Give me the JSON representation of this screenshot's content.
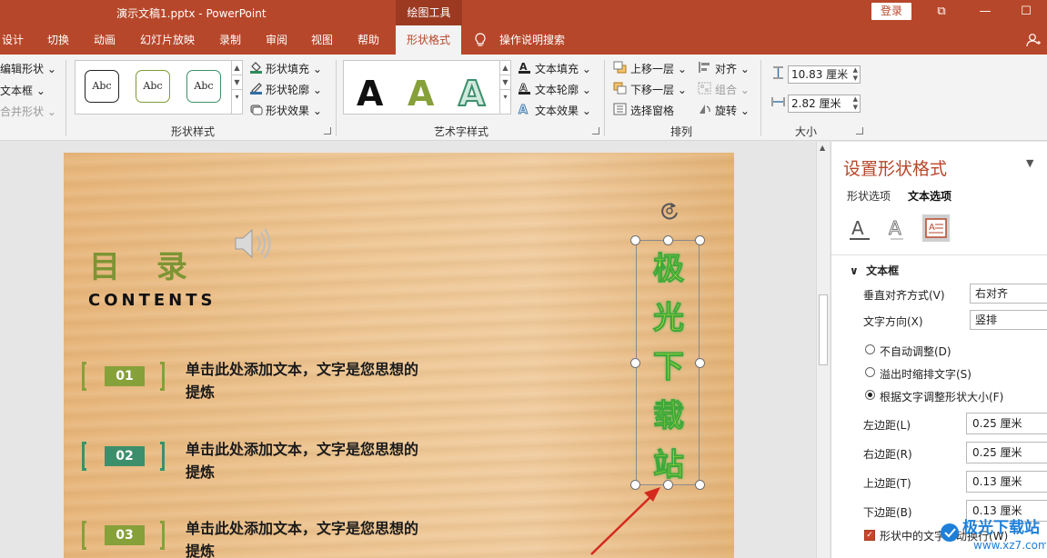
{
  "titlebar": {
    "doc_title": "演示文稿1.pptx  -  PowerPoint",
    "context_tab": "绘图工具",
    "login": "登录",
    "buttons": {
      "restore": "⧉",
      "minimize": "—",
      "maximize": "☐"
    }
  },
  "tabs": [
    {
      "label": "设计",
      "active": false
    },
    {
      "label": "切换",
      "active": false
    },
    {
      "label": "动画",
      "active": false
    },
    {
      "label": "幻灯片放映",
      "active": false
    },
    {
      "label": "录制",
      "active": false
    },
    {
      "label": "审阅",
      "active": false
    },
    {
      "label": "视图",
      "active": false
    },
    {
      "label": "帮助",
      "active": false
    },
    {
      "label": "形状格式",
      "active": true
    },
    {
      "label": "操作说明搜索",
      "active": false
    }
  ],
  "ribbon": {
    "insert_shapes": {
      "edit_shape": "编辑形状 ⌄",
      "text_box": "文本框 ⌄",
      "merge_shapes": "合并形状 ⌄"
    },
    "shape_styles": {
      "label": "形状样式",
      "samples": [
        "Abc",
        "Abc",
        "Abc"
      ],
      "fill": "形状填充 ⌄",
      "outline": "形状轮廓 ⌄",
      "effects": "形状效果 ⌄"
    },
    "wordart": {
      "label": "艺术字样式",
      "samples": [
        "A",
        "A",
        "A"
      ],
      "text_fill": "文本填充 ⌄",
      "text_outline": "文本轮廓 ⌄",
      "text_effects": "文本效果 ⌄"
    },
    "arrange": {
      "label": "排列",
      "bring_forward": "上移一层 ⌄",
      "send_backward": "下移一层 ⌄",
      "selection_pane": "选择窗格",
      "align": "对齐 ⌄",
      "group": "组合 ⌄",
      "rotate": "旋转 ⌄"
    },
    "size": {
      "label": "大小",
      "height": "10.83 厘米",
      "width": "2.82 厘米"
    }
  },
  "slide": {
    "title": "目 录",
    "subtitle": "CONTENTS",
    "items": [
      {
        "num": "01",
        "text": "单击此处添加文本，文字是您思想的提炼",
        "color": "#86a03a"
      },
      {
        "num": "02",
        "text": "单击此处添加文本，文字是您思想的提炼",
        "color": "#3d8f6c"
      },
      {
        "num": "03",
        "text": "单击此处添加文本，文字是您思想的提炼",
        "color": "#86a03a"
      }
    ],
    "vertical_text": "极光下载站"
  },
  "pane": {
    "title": "设置形状格式",
    "tab_shape": "形状选项",
    "tab_text": "文本选项",
    "section": "文本框",
    "vertical_align_label": "垂直对齐方式(V)",
    "vertical_align_value": "右对齐",
    "text_direction_label": "文字方向(X)",
    "text_direction_value": "竖排",
    "autofit_none": "不自动调整(D)",
    "autofit_shrink": "溢出时缩排文字(S)",
    "autofit_resize": "根据文字调整形状大小(F)",
    "left_margin_label": "左边距(L)",
    "left_margin": "0.25 厘米",
    "right_margin_label": "右边距(R)",
    "right_margin": "0.25 厘米",
    "top_margin_label": "上边距(T)",
    "top_margin": "0.13 厘米",
    "bottom_margin_label": "下边距(B)",
    "bottom_margin": "0.13 厘米",
    "wrap_text": "形状中的文字自动换行(W)"
  },
  "colors": {
    "accent": "#b7472a",
    "wordart_green": "#d8f13a"
  }
}
